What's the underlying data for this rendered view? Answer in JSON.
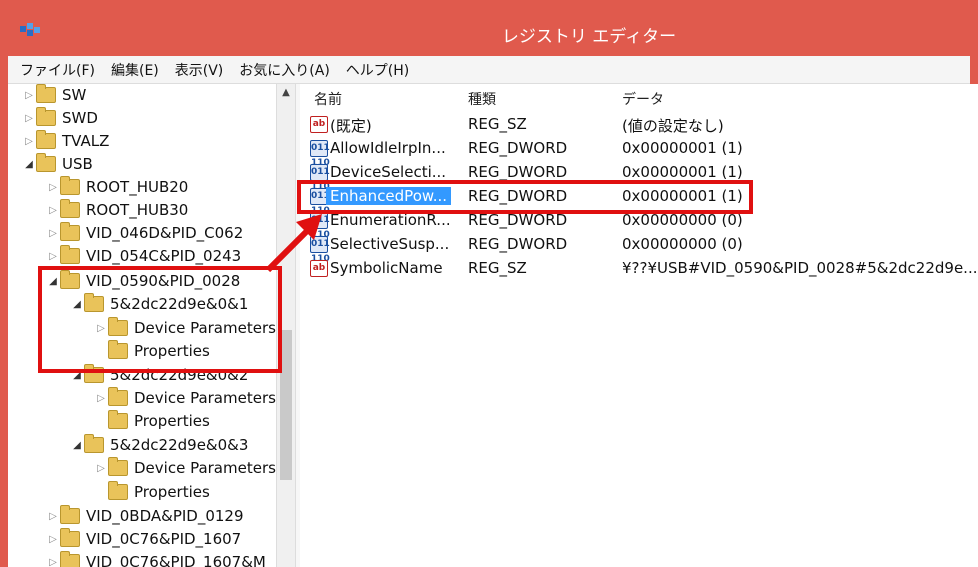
{
  "window": {
    "title": "レジストリ エディター",
    "accent_color": "#e05a4d",
    "selection_color": "#3399ff",
    "annotation_color": "#e01010"
  },
  "menu": [
    {
      "label": "ファイル(F)"
    },
    {
      "label": "編集(E)"
    },
    {
      "label": "表示(V)"
    },
    {
      "label": "お気に入り(A)"
    },
    {
      "label": "ヘルプ(H)"
    }
  ],
  "tree": {
    "items": [
      {
        "label": "SW",
        "expander": "collapsed"
      },
      {
        "label": "SWD",
        "expander": "collapsed"
      },
      {
        "label": "TVALZ",
        "expander": "collapsed"
      },
      {
        "label": "USB",
        "expander": "expanded"
      },
      {
        "label": "ROOT_HUB20",
        "expander": "collapsed"
      },
      {
        "label": "ROOT_HUB30",
        "expander": "collapsed"
      },
      {
        "label": "VID_046D&PID_C062",
        "expander": "collapsed"
      },
      {
        "label": "VID_054C&PID_0243",
        "expander": "collapsed"
      },
      {
        "label": "VID_0590&PID_0028",
        "expander": "expanded"
      },
      {
        "label": "5&2dc22d9e&0&1",
        "expander": "expanded"
      },
      {
        "label": "Device Parameters",
        "expander": "collapsed"
      },
      {
        "label": "Properties",
        "expander": "none"
      },
      {
        "label": "5&2dc22d9e&0&2",
        "expander": "expanded"
      },
      {
        "label": "Device Parameters",
        "expander": "collapsed"
      },
      {
        "label": "Properties",
        "expander": "none"
      },
      {
        "label": "5&2dc22d9e&0&3",
        "expander": "expanded"
      },
      {
        "label": "Device Parameters",
        "expander": "collapsed"
      },
      {
        "label": "Properties",
        "expander": "none"
      },
      {
        "label": "VID_0BDA&PID_0129",
        "expander": "collapsed"
      },
      {
        "label": "VID_0C76&PID_1607",
        "expander": "collapsed"
      },
      {
        "label": "VID_0C76&PID_1607&M",
        "expander": "collapsed"
      }
    ]
  },
  "list": {
    "columns": {
      "name": "名前",
      "type": "種類",
      "data": "データ"
    },
    "rows": [
      {
        "icon": "ab",
        "name": "(既定)",
        "type": "REG_SZ",
        "data": "(値の設定なし)"
      },
      {
        "icon": "dword",
        "name": "AllowIdleIrpIn...",
        "type": "REG_DWORD",
        "data": "0x00000001 (1)"
      },
      {
        "icon": "dword",
        "name": "DeviceSelecti...",
        "type": "REG_DWORD",
        "data": "0x00000001 (1)"
      },
      {
        "icon": "dword",
        "name": "EnhancedPow...",
        "type": "REG_DWORD",
        "data": "0x00000001 (1)",
        "selected": true
      },
      {
        "icon": "dword",
        "name": "EnumerationR...",
        "type": "REG_DWORD",
        "data": "0x00000000 (0)"
      },
      {
        "icon": "dword",
        "name": "SelectiveSusp...",
        "type": "REG_DWORD",
        "data": "0x00000000 (0)"
      },
      {
        "icon": "ab",
        "name": "SymbolicName",
        "type": "REG_SZ",
        "data": "¥??¥USB#VID_0590&PID_0028#5&2dc22d9e..."
      }
    ]
  },
  "icons": {
    "app": "registry-editor-icon",
    "string_value": "ab",
    "dword_value": "011 110"
  }
}
